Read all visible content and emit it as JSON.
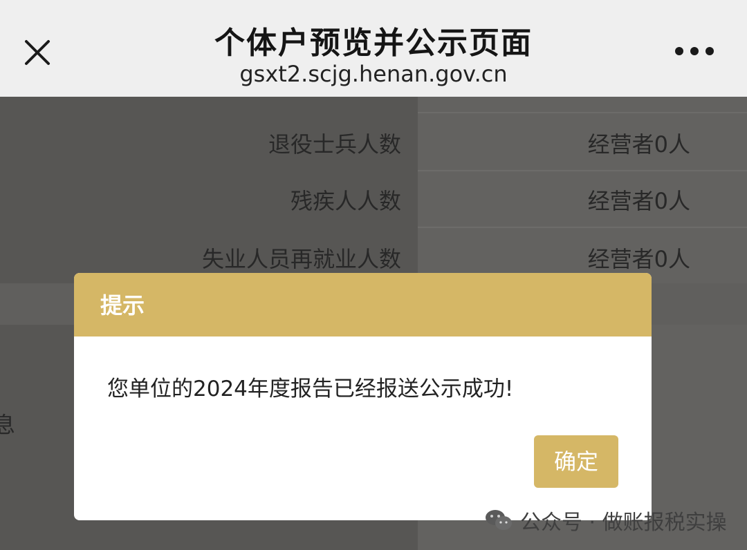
{
  "header": {
    "title": "个体户预览并公示页面",
    "url": "gsxt2.scjg.henan.gov.cn"
  },
  "rows": [
    {
      "label": "退役士兵人数",
      "value": "经营者0人"
    },
    {
      "label": "残疾人人数",
      "value": "经营者0人"
    },
    {
      "label": "失业人员再就业人数",
      "value": "经营者0人"
    }
  ],
  "partial_label": "息",
  "dialog": {
    "title": "提示",
    "message": "您单位的2024年度报告已经报送公示成功!",
    "ok_label": "确定"
  },
  "watermark": {
    "text": "公众号 · 做账报税实操"
  },
  "colors": {
    "accent": "#d5b766",
    "topbar": "#efefef",
    "overlay": "#575654"
  },
  "icons": {
    "close": "close-icon",
    "more": "more-dots-icon",
    "watermark": "wechat-icon"
  }
}
